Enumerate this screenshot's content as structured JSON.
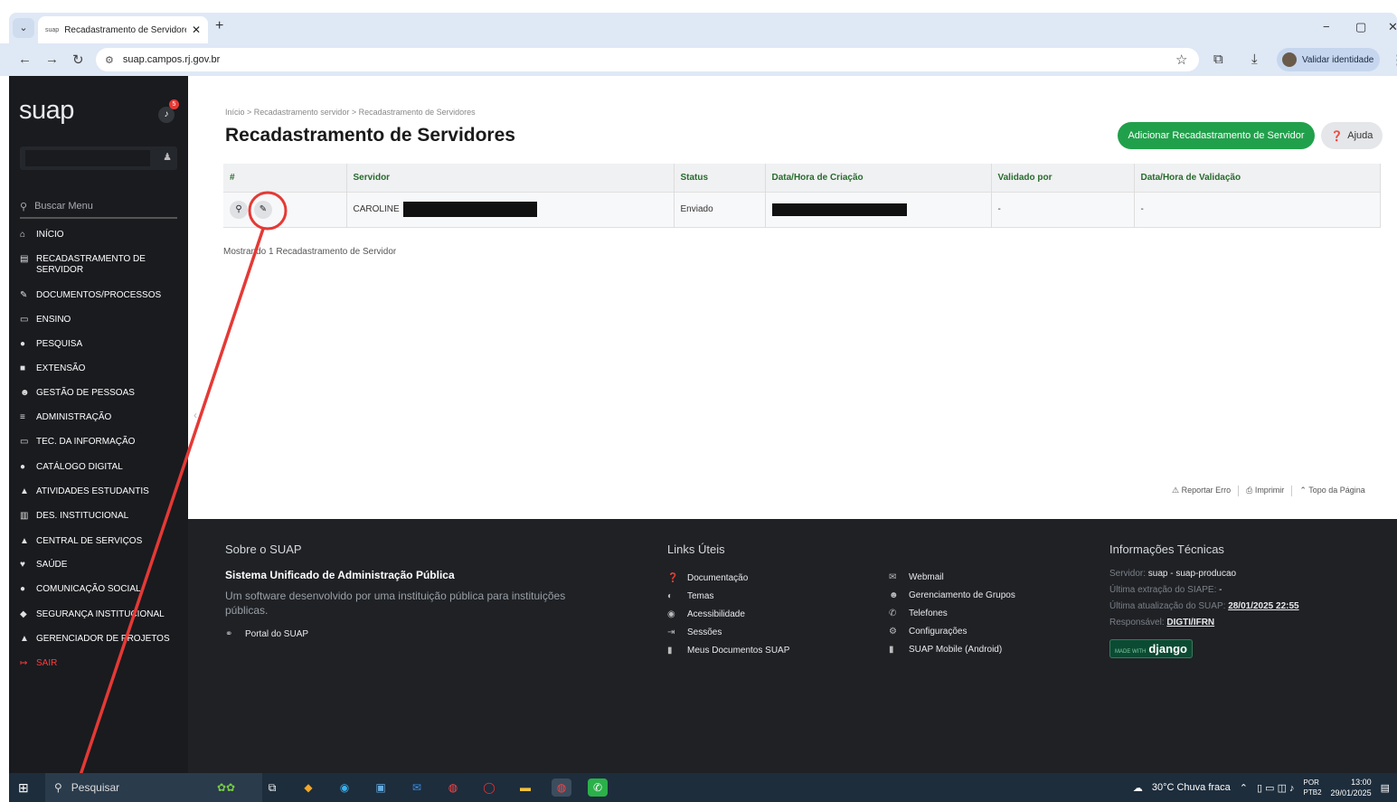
{
  "browser": {
    "tab_title": "Recadastramento de Servidores",
    "tab_favicon": "suap",
    "url": "suap.campos.rj.gov.br",
    "profile_label": "Validar identidade",
    "icons": [
      "back-icon",
      "forward-icon",
      "reload-icon",
      "star-icon",
      "extensions-icon",
      "download-icon",
      "menu-icon"
    ]
  },
  "sidebar": {
    "logo": "suap",
    "notification_count": "5",
    "search_placeholder": "Buscar Menu",
    "items": [
      {
        "label": "Início",
        "icon": "⌂"
      },
      {
        "label": "Recadastramento de Servidor",
        "icon": "▤"
      },
      {
        "label": "Documentos/Processos",
        "icon": "✎"
      },
      {
        "label": "Ensino",
        "icon": "▭"
      },
      {
        "label": "Pesquisa",
        "icon": "●"
      },
      {
        "label": "Extensão",
        "icon": "■"
      },
      {
        "label": "Gestão de Pessoas",
        "icon": "☻"
      },
      {
        "label": "Administração",
        "icon": "≡"
      },
      {
        "label": "Tec. da Informação",
        "icon": "▭"
      },
      {
        "label": "Catálogo Digital",
        "icon": "●"
      },
      {
        "label": "Atividades Estudantis",
        "icon": "▲"
      },
      {
        "label": "Des. Institucional",
        "icon": "▥"
      },
      {
        "label": "Central de Serviços",
        "icon": "▲"
      },
      {
        "label": "Saúde",
        "icon": "♥"
      },
      {
        "label": "Comunicação Social",
        "icon": "●"
      },
      {
        "label": "Segurança Institucional",
        "icon": "◆"
      },
      {
        "label": "Gerenciador de Projetos",
        "icon": "▲"
      },
      {
        "label": "Sair",
        "icon": "↦"
      }
    ]
  },
  "main": {
    "breadcrumb": "Início > Recadastramento servidor > Recadastramento de Servidores",
    "title": "Recadastramento de Servidores",
    "add_button": "Adicionar Recadastramento de Servidor",
    "help_button": "Ajuda",
    "table": {
      "headers": [
        "#",
        "Servidor",
        "Status",
        "Data/Hora de Criação",
        "Validado por",
        "Data/Hora de Validação"
      ],
      "rows": [
        {
          "servidor": "CAROLINE",
          "status": "Enviado",
          "validado_por": "-",
          "data_validacao": "-"
        }
      ]
    },
    "count_text": "Mostrando 1 Recadastramento de Servidor",
    "page_footer": {
      "report": "Reportar Erro",
      "print": "Imprimir",
      "top": "Topo da Página"
    }
  },
  "footer": {
    "about": {
      "heading": "Sobre o SUAP",
      "name": "Sistema Unificado de Administração Pública",
      "description": "Um software desenvolvido por uma instituição pública para instituições públicas.",
      "portal_link": "Portal do SUAP"
    },
    "links": {
      "heading": "Links Úteis",
      "col1": [
        "Documentação",
        "Temas",
        "Acessibilidade",
        "Sessões",
        "Meus Documentos SUAP"
      ],
      "col2": [
        "Webmail",
        "Gerenciamento de Grupos",
        "Telefones",
        "Configurações",
        "SUAP Mobile (Android)"
      ]
    },
    "tech": {
      "heading": "Informações Técnicas",
      "server_label": "Servidor:",
      "server_value": "suap - suap-producao",
      "siape_label": "Última extração do SIAPE:",
      "siape_value": "-",
      "update_label": "Última atualização do SUAP:",
      "update_value": "28/01/2025 22:55",
      "resp_label": "Responsável:",
      "resp_value": "DIGTI/IFRN",
      "django_small": "MADE WITH",
      "django_big": "django"
    }
  },
  "taskbar": {
    "search_placeholder": "Pesquisar",
    "weather": "30°C  Chuva fraca",
    "lang": "POR",
    "lang2": "PTB2",
    "time": "13:00",
    "date": "29/01/2025"
  }
}
